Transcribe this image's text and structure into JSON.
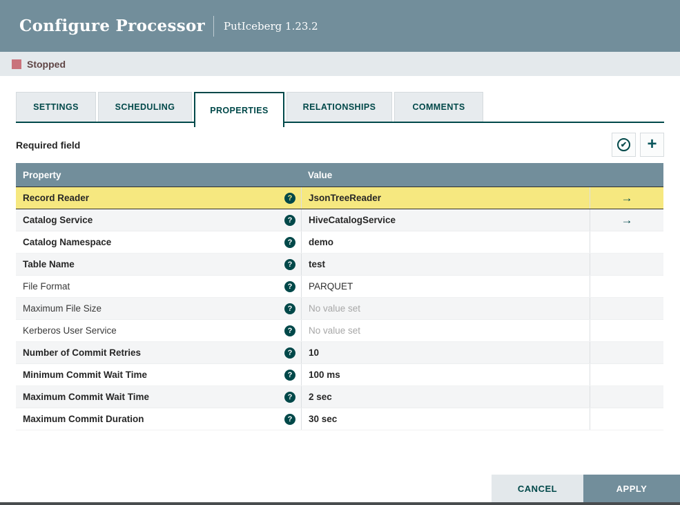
{
  "header": {
    "title": "Configure Processor",
    "subtitle": "PutIceberg 1.23.2"
  },
  "status": {
    "label": "Stopped",
    "color": "#c9737c"
  },
  "tabs": [
    {
      "label": "SETTINGS"
    },
    {
      "label": "SCHEDULING"
    },
    {
      "label": "PROPERTIES",
      "active": true
    },
    {
      "label": "RELATIONSHIPS"
    },
    {
      "label": "COMMENTS"
    }
  ],
  "toolbar": {
    "required_label": "Required field",
    "verify_icon": "verify-properties-check-circle",
    "add_icon": "add-property-plus",
    "check_glyph": "✔",
    "plus_glyph": "+"
  },
  "table": {
    "columns": [
      "Property",
      "Value"
    ],
    "help_glyph": "?",
    "arrow_glyph": "→",
    "rows": [
      {
        "property": "Record Reader",
        "value": "JsonTreeReader",
        "bold": true,
        "no_value": false,
        "go_to": true,
        "highlight": true
      },
      {
        "property": "Catalog Service",
        "value": "HiveCatalogService",
        "bold": true,
        "no_value": false,
        "go_to": true,
        "highlight": false
      },
      {
        "property": "Catalog Namespace",
        "value": "demo",
        "bold": true,
        "no_value": false,
        "go_to": false,
        "highlight": false
      },
      {
        "property": "Table Name",
        "value": "test",
        "bold": true,
        "no_value": false,
        "go_to": false,
        "highlight": false
      },
      {
        "property": "File Format",
        "value": "PARQUET",
        "bold": false,
        "no_value": false,
        "go_to": false,
        "highlight": false
      },
      {
        "property": "Maximum File Size",
        "value": "No value set",
        "bold": false,
        "no_value": true,
        "go_to": false,
        "highlight": false
      },
      {
        "property": "Kerberos User Service",
        "value": "No value set",
        "bold": false,
        "no_value": true,
        "go_to": false,
        "highlight": false
      },
      {
        "property": "Number of Commit Retries",
        "value": "10",
        "bold": true,
        "no_value": false,
        "go_to": false,
        "highlight": false
      },
      {
        "property": "Minimum Commit Wait Time",
        "value": "100 ms",
        "bold": true,
        "no_value": false,
        "go_to": false,
        "highlight": false
      },
      {
        "property": "Maximum Commit Wait Time",
        "value": "2 sec",
        "bold": true,
        "no_value": false,
        "go_to": false,
        "highlight": false
      },
      {
        "property": "Maximum Commit Duration",
        "value": "30 sec",
        "bold": true,
        "no_value": false,
        "go_to": false,
        "highlight": false
      }
    ]
  },
  "footer": {
    "cancel": "CANCEL",
    "apply": "APPLY"
  },
  "colors": {
    "header_bg": "#728e9b",
    "accent_teal": "#004849",
    "selected_row": "#f6e880",
    "status_bar_bg": "#e4e9ec",
    "apply_bg": "#728e9b",
    "cancel_bg": "#e3e8eb"
  }
}
